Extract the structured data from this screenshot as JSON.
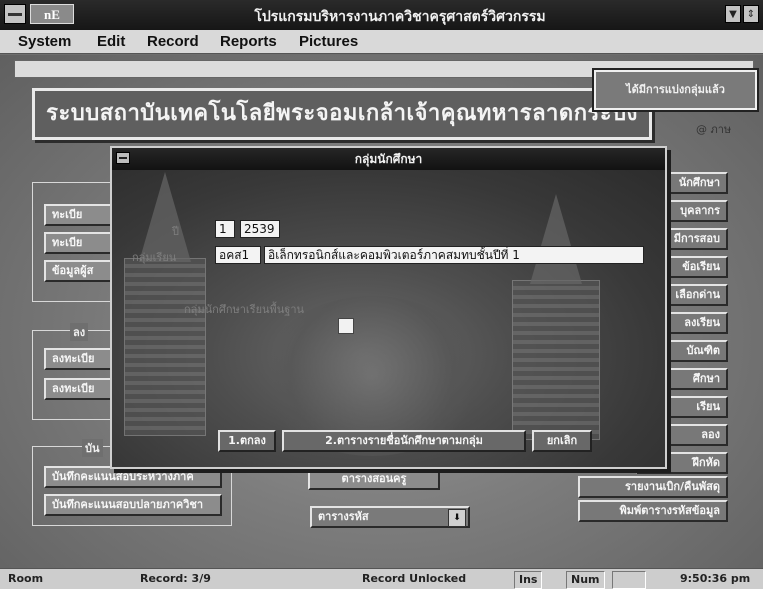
{
  "window": {
    "title": "โปรแกรมบริหารงานภาควิชาครุศาสตร์วิศวกรรม",
    "app_icon_text": "nE",
    "minimize_glyph": "▼",
    "restore_glyph": "⇕"
  },
  "menu": [
    "System",
    "Edit",
    "Record",
    "Reports",
    "Pictures"
  ],
  "main": {
    "banner": "ระบบสถาบันเทคโนโลยีพระจอมเกล้าเจ้าคุณทหารลาดกระบัง",
    "notice": "ได้มีการแบ่งกลุ่มแล้ว",
    "help_link": "@ ภาษ",
    "left_group1": {
      "buttons": [
        "ทะเบีย",
        "ทะเบีย",
        "ข้อมูลผู้ส"
      ]
    },
    "left_group2": {
      "label": "ลง",
      "buttons": [
        "ลงทะเบีย",
        "ลงทะเบีย"
      ]
    },
    "left_group3": {
      "label": "บัน",
      "buttons": [
        "บันทึกคะแนนสอบระหว่างภาค",
        "บันทึกคะแนนสอบปลายภาควิชา"
      ]
    },
    "center_button": "ตารางสอนครู",
    "combo_value": "ตารางรหัส",
    "combo_arrow_glyph": "⬇",
    "right_buttons": [
      "นักศึกษา",
      "บุคลากร",
      "มีการสอบ",
      "ข้อเรียน",
      "เลือกด่าน",
      "ลงเรียน",
      "บัณฑิต",
      "ศึกษา",
      "เรียน",
      "ลอง",
      "ฝึกหัด",
      "รายงานเบิก/คืนพัสดุ",
      "พิมพ์ตารางรหัสข้อมูล"
    ]
  },
  "dialog": {
    "title": "กลุ่มนักศึกษา",
    "label_year": "ปี",
    "label_group": "กลุ่มเรียน",
    "label_check": "กลุ่มนักศึกษาเรียนพื้นฐาน",
    "semester": "1",
    "year": "2539",
    "group_code": "อคส1",
    "group_name": "อิเล็กทรอนิกส์และคอมพิวเตอร์ภาคสมทบชั้นปีที่ 1",
    "check_state": "unchecked",
    "buttons": {
      "ok": "1.ตกลง",
      "list": "2.ตารางรายชื่อนักศึกษาตามกลุ่ม",
      "cancel": "ยกเลิก"
    }
  },
  "status": {
    "room": "Room",
    "record": "Record: 3/9",
    "lock": "Record Unlocked",
    "ins": "Ins",
    "num": "Num",
    "time": "9:50:36 pm"
  }
}
